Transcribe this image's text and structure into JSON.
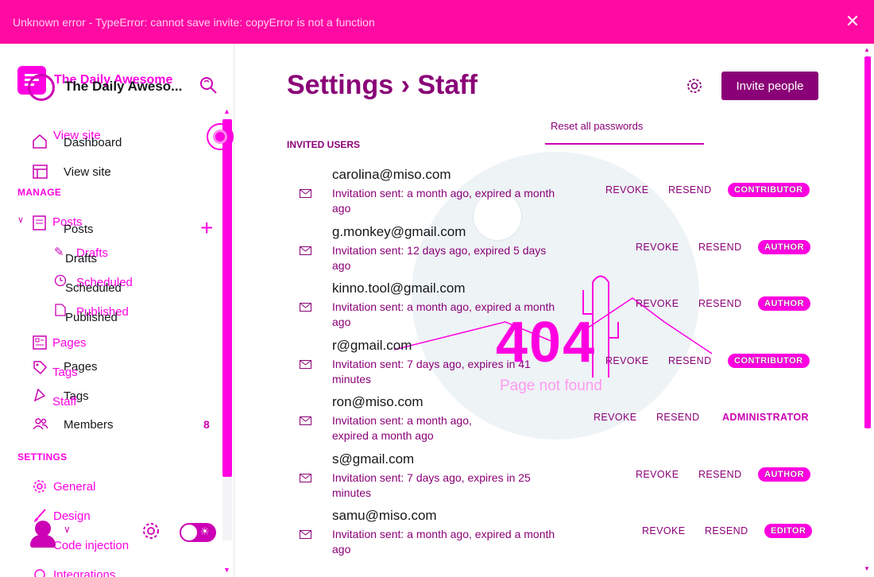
{
  "alert": {
    "message": "Unknown error - TypeError: cannot save invite: copyError is not a function",
    "close_icon": "close-icon"
  },
  "sidebar": {
    "brand_title": "The Daily Awesome",
    "brand_title_truncated": "The Daily Aweso...",
    "top_items": [
      {
        "label": "Dashboard",
        "icon": "home-icon"
      },
      {
        "label": "View site",
        "icon": "browser-icon"
      }
    ],
    "ghost_view_site": "View site",
    "manage_heading": "MANAGE",
    "posts": {
      "label": "Posts",
      "ghost_label": "Posts",
      "sub_items": [
        {
          "label": "Drafts",
          "ghost": "Drafts"
        },
        {
          "label": "Scheduled",
          "ghost": "Scheduled"
        },
        {
          "label": "Published",
          "ghost": "Published"
        }
      ]
    },
    "pages_label": "Pages",
    "pages_ghost": "Pages",
    "tags_label": "Tags",
    "tags_ghost": "Tags",
    "staff_ghost": "Staff",
    "members": {
      "label": "Members",
      "count": "8"
    },
    "settings_heading": "SETTINGS",
    "settings_items": [
      {
        "label": "General",
        "icon": "gear-icon"
      },
      {
        "label": "Design",
        "icon": "brush-icon"
      },
      {
        "label": "Code injection",
        "icon": "code-icon"
      },
      {
        "label": "Integrations",
        "icon": "plug-icon"
      }
    ]
  },
  "main": {
    "title": "Settings › Staff",
    "invite_button": "Invite people",
    "reset_link": "Reset all passwords",
    "invited_heading": "INVITED USERS",
    "actions": {
      "revoke": "REVOKE",
      "resend": "RESEND"
    },
    "overlay_404": "404",
    "overlay_not_found": "Page not found",
    "users": [
      {
        "email": "carolina@miso.com",
        "status": "Invitation sent: a month ago, expired a month ago",
        "role": "CONTRIBUTOR",
        "badge": true
      },
      {
        "email": "g.monkey@gmail.com",
        "status": "Invitation sent: 12 days ago, expired 5 days ago",
        "role": "AUTHOR",
        "badge": true
      },
      {
        "email": "kinno.tool@gmail.com",
        "status": "Invitation sent: a month ago, expired a month ago",
        "role": "AUTHOR",
        "badge": true
      },
      {
        "email": "r@gmail.com",
        "status": "Invitation sent: 7 days ago, expires in 41 minutes",
        "role": "CONTRIBUTOR",
        "badge": true
      },
      {
        "email": "ron@miso.com",
        "status": "Invitation sent: a month ago, expired a month ago",
        "role": "ADMINISTRATOR",
        "badge": false
      },
      {
        "email": "s@gmail.com",
        "status": "Invitation sent: 7 days ago, expires in 25 minutes",
        "role": "AUTHOR",
        "badge": true
      },
      {
        "email": "samu@miso.com",
        "status": "Invitation sent: a month ago, expired a month ago",
        "role": "EDITOR",
        "badge": true
      }
    ]
  },
  "colors": {
    "accent": "#ff00e1",
    "accent_dark": "#8a0077",
    "alert_bg": "#ff0aa2"
  }
}
